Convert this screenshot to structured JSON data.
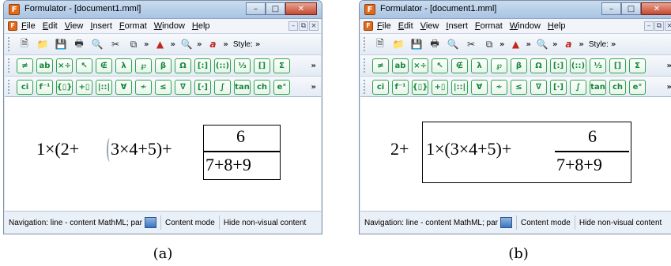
{
  "panels": [
    {
      "caption": "(a)",
      "window": {
        "title": "Formulator - [document1.mml]",
        "menu": [
          "File",
          "Edit",
          "View",
          "Insert",
          "Format",
          "Window",
          "Help"
        ],
        "style_label": "Style:",
        "status": {
          "nav": "Navigation: line - content MathML; par",
          "mode": "Content mode",
          "hide": "Hide non-visual content"
        }
      },
      "formula": {
        "prefix": "1×(2+",
        "caret_after": "3×4+5)+",
        "numerator": "6",
        "denominator": "7+8+9"
      }
    },
    {
      "caption": "(b)",
      "window": {
        "title": "Formulator - [document1.mml]",
        "menu": [
          "File",
          "Edit",
          "View",
          "Insert",
          "Format",
          "Window",
          "Help"
        ],
        "style_label": "Style:",
        "status": {
          "nav": "Navigation: line - content MathML; par",
          "mode": "Content mode",
          "hide": "Hide non-visual content"
        }
      },
      "formula": {
        "prefix": "2+",
        "boxed": "1×(3×4+5)+",
        "numerator": "6",
        "denominator": "7+8+9"
      }
    }
  ],
  "toolbar": {
    "standard_icons": [
      "new-doc",
      "open-folder",
      "save-disk",
      "print",
      "preview",
      "cut-scissors",
      "copy",
      "pdf-export",
      "zoom",
      "mathml-a"
    ],
    "row2_symbols": [
      "≠",
      "ab",
      "×÷",
      "↖",
      "∉",
      "λ",
      "℘",
      "β",
      "Ω",
      "[:]",
      "(::)",
      "⅓",
      "[]",
      "Σ"
    ],
    "row3_symbols": [
      "ci",
      "f⁻¹",
      "{▯}",
      "+▯",
      "|::|",
      "∀",
      "≁",
      "≤",
      "∇",
      "[·]",
      "∫",
      "tan",
      "ch",
      "e°"
    ],
    "more": "»"
  },
  "colors": {
    "titlebar": "#b4cce6",
    "toolbar_green": "#14873a",
    "accent_orange": "#e1691b"
  }
}
